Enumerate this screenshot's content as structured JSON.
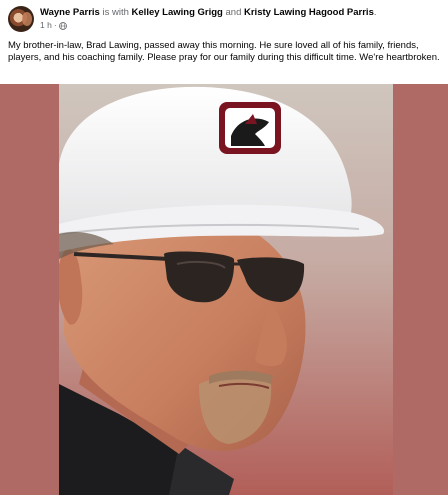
{
  "post": {
    "author": "Wayne Parris",
    "with_text": "is with",
    "tagged_1": "Kelley Lawing Grigg",
    "and_text": "and",
    "tagged_2": "Kristy Lawing Hagood Parris",
    "trailing_period": ".",
    "time": "1 h",
    "separator": "·",
    "audience_icon": "globe-icon",
    "text": "My brother-in-law, Brad Lawing, passed away this morning. He sure loved all of his family, friends, players, and his coaching family. Please pray for our family during this difficult time. We're heartbroken."
  },
  "colors": {
    "media_background": "#b06a65",
    "meta_gray": "#65676b",
    "cap_logo_red": "#7a1420"
  }
}
